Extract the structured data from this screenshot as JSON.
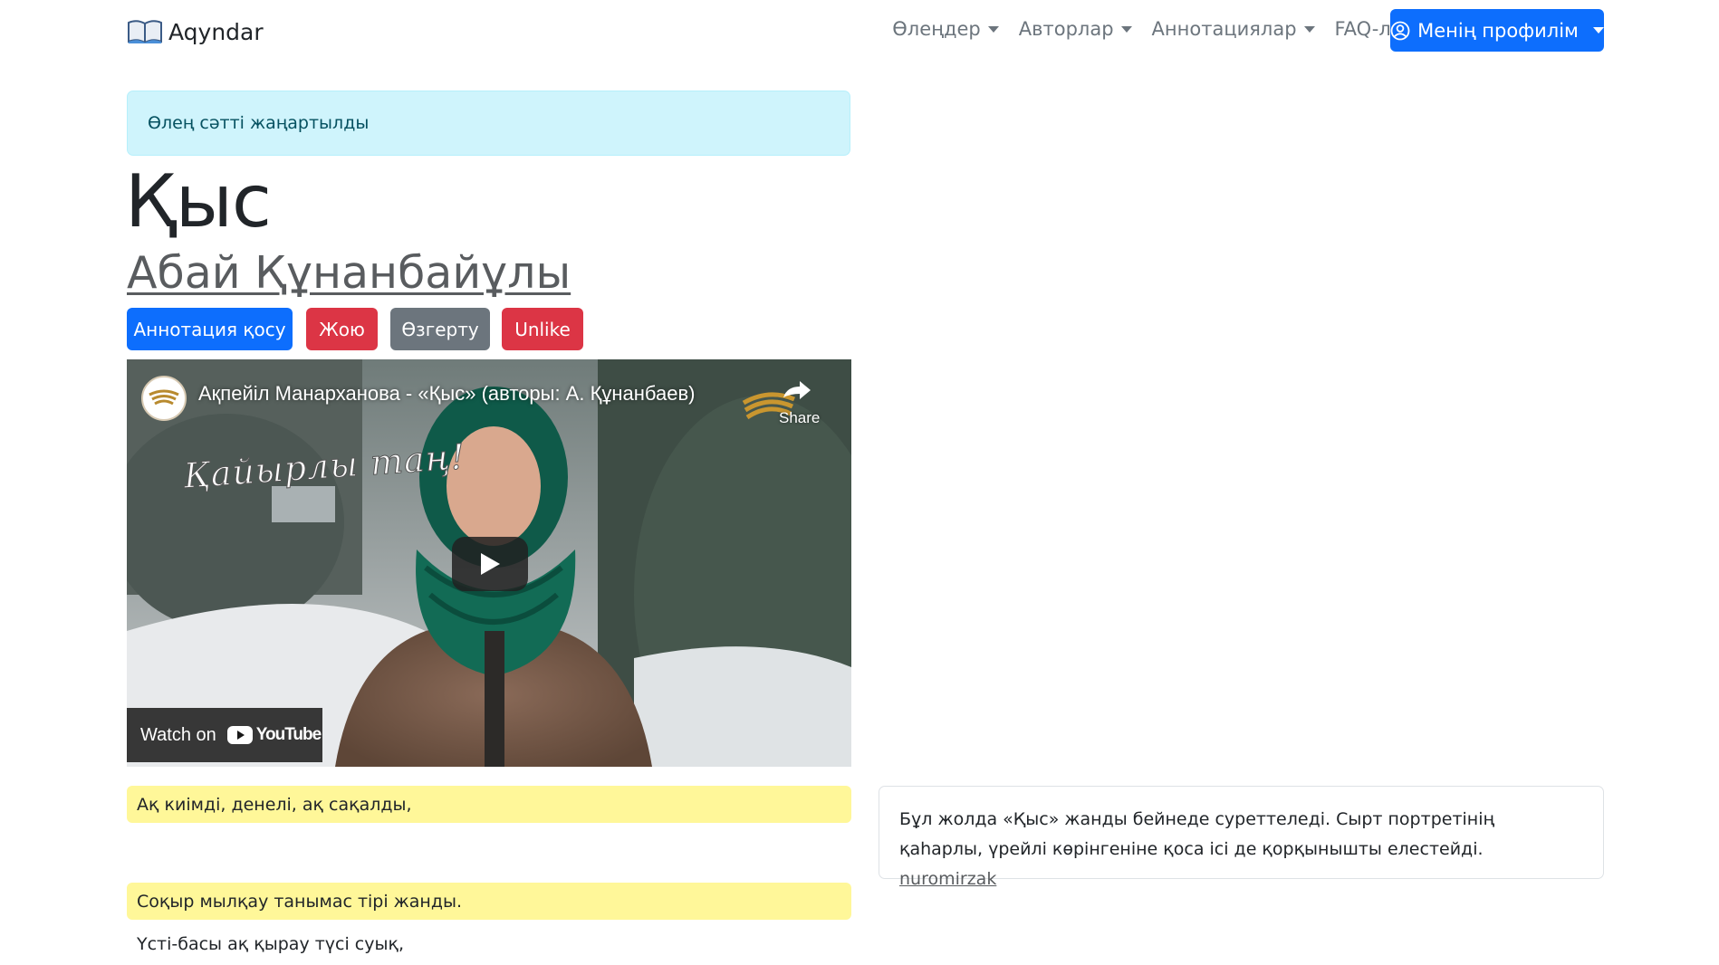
{
  "navbar": {
    "brand": "Aqyndar",
    "links": [
      {
        "label": "Өлеңдер",
        "dropdown": true
      },
      {
        "label": "Авторлар",
        "dropdown": true
      },
      {
        "label": "Аннотациялар",
        "dropdown": true
      },
      {
        "label": "FAQ-лар",
        "dropdown": false
      }
    ],
    "profile_label": "Менің профилім"
  },
  "alert": {
    "message": "Өлең сәтті жаңартылды"
  },
  "poem": {
    "title": "Қыс",
    "author": "Абай Құнанбайұлы",
    "lines": [
      "Ақ киімді, денелі, ақ сақалды,",
      "Соқыр мылқау танымас тірі жанды.",
      "Үсті-басы ақ қырау түсі суық,"
    ]
  },
  "actions": {
    "add_annotation": "Аннотация қосу",
    "delete": "Жою",
    "edit": "Өзгерту",
    "unlike": "Unlike"
  },
  "video": {
    "title": "Ақпейіл Манарханова - «Қыс» (авторы: А. Құнанбаев)",
    "share_label": "Share",
    "overlay_caption": "Қайырлы таң!",
    "watch_on": "Watch on",
    "youtube_label": "YouTube"
  },
  "annotation": {
    "text": "Бұл жолда «Қыс» жанды бейнеде суреттеледі. Сырт портретінің қаһарлы, үрейлі көрінгеніне қоса ісі де қорқынышты елестейді.",
    "user": "nuromirzak"
  },
  "colors": {
    "primary": "#0d6efd",
    "danger": "#dc3545",
    "secondary": "#6c757d",
    "alert_bg": "#cff4fc",
    "highlight": "#fff799"
  }
}
